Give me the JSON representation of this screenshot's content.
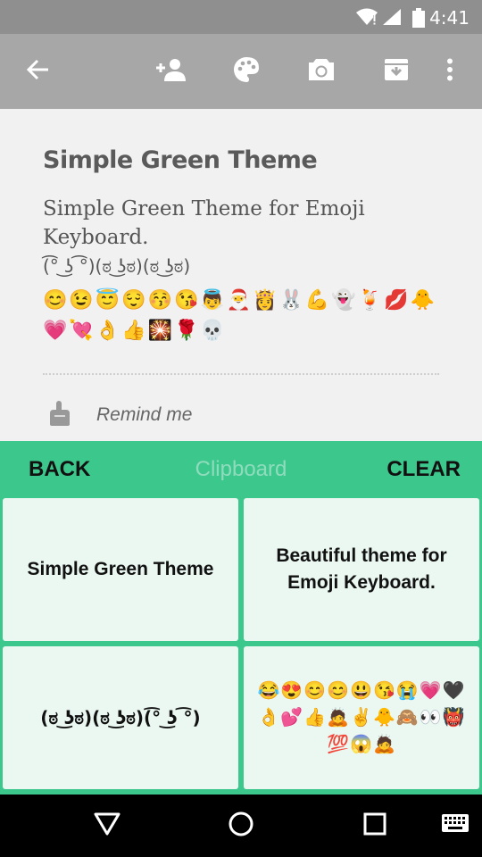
{
  "status_bar": {
    "time": "4:41"
  },
  "toolbar": {
    "icons": [
      "arrow-back-icon",
      "person-add-icon",
      "palette-icon",
      "camera-icon",
      "archive-icon",
      "more-vert-icon"
    ]
  },
  "note": {
    "title": "Simple Green Theme",
    "body_line": "Simple Green Theme for  Emoji Keyboard.",
    "faces": "(͡° ͜ʖ ͡°)(ಠ ͜ʖಠ)(ಠ ͜ʖಠ)",
    "emoji_row_1": "😊😉😇😌😚😘👼🎅👸🐰💪👻🍹💋🐥",
    "emoji_row_2": "💗💘👌👍🎇🌹💀",
    "remind_label": "Remind me"
  },
  "clipboard": {
    "back_label": "BACK",
    "title": "Clipboard",
    "clear_label": "CLEAR",
    "items": [
      "Simple Green Theme",
      "Beautiful theme for Emoji Keyboard.",
      "(ಠ ͜ʖಠ)(ಠ ͜ʖಠ)(͡° ͜ʖ ͡°)",
      "😂😍😊😊😃😘😭💗🖤👌💕👍🙇✌🐥🙈👀👹💯😱🙇"
    ]
  },
  "colors": {
    "accent_green": "#3cc78d",
    "card_bg": "#eaf8f1",
    "toolbar_gray": "#a7a7a7"
  }
}
